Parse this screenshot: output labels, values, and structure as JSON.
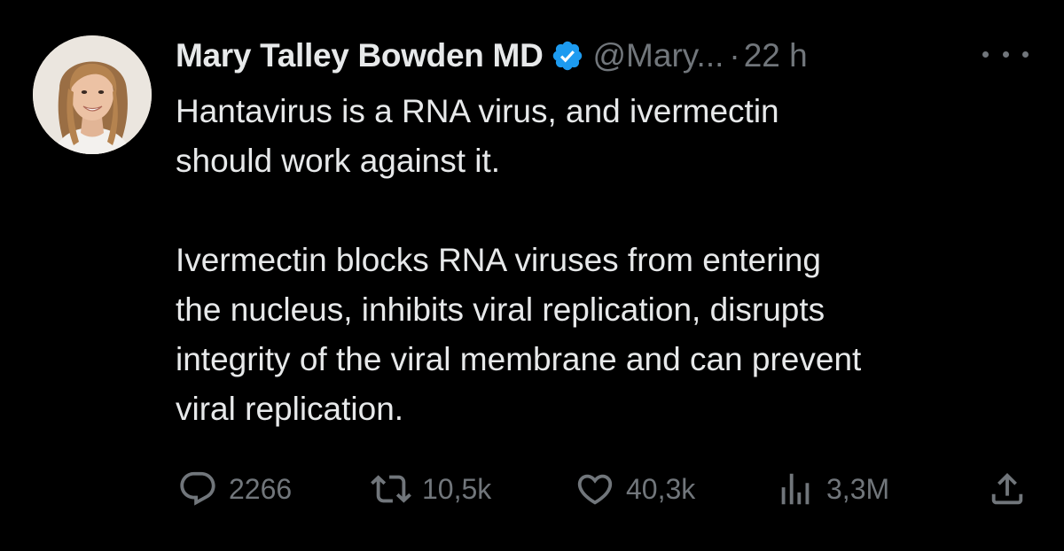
{
  "post": {
    "author_name": "Mary Talley Bowden MD",
    "handle": "@Mary...",
    "separator": "·",
    "time": "22 h",
    "verified": true,
    "paragraphs": [
      [
        "Hantavirus is a RNA virus, and ivermectin",
        "should work against it."
      ],
      [
        "Ivermectin blocks RNA viruses from entering",
        "the nucleus, inhibits viral replication, disrupts",
        "integrity of the viral membrane and can prevent",
        "viral replication."
      ]
    ]
  },
  "actions": {
    "replies": "2266",
    "reposts": "10,5k",
    "likes": "40,3k",
    "views": "3,3M"
  },
  "icons": {
    "verified": "verified-badge-icon",
    "more": "more-dots-icon",
    "reply": "reply-bubble-icon",
    "repost": "repost-arrows-icon",
    "like": "heart-icon",
    "views": "views-bars-icon",
    "share": "share-upload-icon"
  },
  "colors": {
    "background": "#000000",
    "text_primary": "#e7e9ea",
    "text_secondary": "#71767b",
    "verified_blue": "#1d9bf0"
  }
}
